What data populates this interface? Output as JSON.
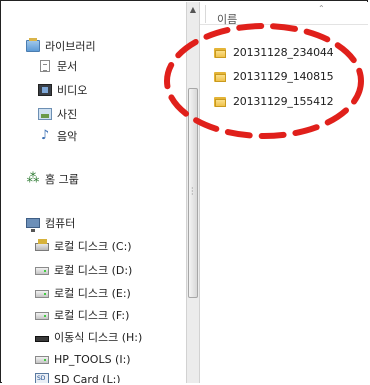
{
  "navigation": {
    "libraries": {
      "label": "라이브러리",
      "items": [
        {
          "label": "문서",
          "icon": "document-icon"
        },
        {
          "label": "비디오",
          "icon": "video-icon"
        },
        {
          "label": "사진",
          "icon": "picture-icon"
        },
        {
          "label": "음악",
          "icon": "music-icon"
        }
      ]
    },
    "homegroup": {
      "label": "홈 그룹",
      "icon": "homegroup-icon"
    },
    "computer": {
      "label": "컴퓨터",
      "drives": [
        {
          "label": "로컬 디스크 (C:)",
          "icon": "system-drive-icon"
        },
        {
          "label": "로컬 디스크 (D:)",
          "icon": "drive-icon"
        },
        {
          "label": "로컬 디스크 (E:)",
          "icon": "drive-icon"
        },
        {
          "label": "로컬 디스크 (F:)",
          "icon": "drive-icon"
        },
        {
          "label": "이동식 디스크 (H:)",
          "icon": "removable-drive-icon"
        },
        {
          "label": "HP_TOOLS (I:)",
          "icon": "drive-icon"
        },
        {
          "label": "SD Card (L:)",
          "icon": "sd-card-icon"
        }
      ]
    }
  },
  "content": {
    "column_header": "이름",
    "folders": [
      {
        "name": "20131128_234044"
      },
      {
        "name": "20131129_140815"
      },
      {
        "name": "20131129_155412"
      }
    ]
  },
  "annotation": {
    "color": "#e0201b",
    "style": "dashed-ellipse"
  }
}
